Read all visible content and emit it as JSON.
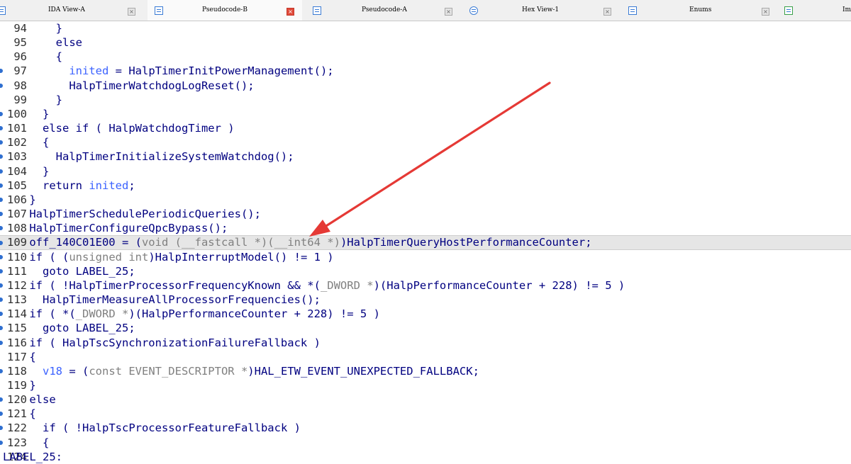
{
  "tabs": [
    {
      "label": "IDA View-A",
      "active": false
    },
    {
      "label": "Pseudocode-B",
      "active": true
    },
    {
      "label": "Pseudocode-A",
      "active": false
    },
    {
      "label": "Hex View-1",
      "active": false
    },
    {
      "label": "Enums",
      "active": false
    },
    {
      "label": "Im",
      "active": false
    }
  ],
  "close_glyph": "×",
  "colors": {
    "code_text": "#000080",
    "type_text": "#808080",
    "variable_text": "#3b62ff",
    "highlight_line": "#e6e6e6",
    "arrow": "#e53935"
  },
  "current_line": "109",
  "code_lines": [
    {
      "num": "94",
      "bp": false,
      "indent": "    ",
      "segments": [
        [
          "}",
          "n"
        ]
      ]
    },
    {
      "num": "95",
      "bp": false,
      "indent": "    ",
      "segments": [
        [
          "else",
          "n"
        ]
      ]
    },
    {
      "num": "96",
      "bp": false,
      "indent": "    ",
      "segments": [
        [
          "{",
          "n"
        ]
      ]
    },
    {
      "num": "97",
      "bp": true,
      "indent": "      ",
      "segments": [
        [
          "inited",
          "v"
        ],
        [
          " = HalpTimerInitPowerManagement();",
          "n"
        ]
      ]
    },
    {
      "num": "98",
      "bp": true,
      "indent": "      ",
      "segments": [
        [
          "HalpTimerWatchdogLogReset();",
          "n"
        ]
      ]
    },
    {
      "num": "99",
      "bp": false,
      "indent": "    ",
      "segments": [
        [
          "}",
          "n"
        ]
      ]
    },
    {
      "num": "100",
      "bp": true,
      "indent": "  ",
      "segments": [
        [
          "}",
          "n"
        ]
      ]
    },
    {
      "num": "101",
      "bp": true,
      "indent": "  ",
      "segments": [
        [
          "else if ( HalpWatchdogTimer )",
          "n"
        ]
      ]
    },
    {
      "num": "102",
      "bp": true,
      "indent": "  ",
      "segments": [
        [
          "{",
          "n"
        ]
      ]
    },
    {
      "num": "103",
      "bp": true,
      "indent": "    ",
      "segments": [
        [
          "HalpTimerInitializeSystemWatchdog();",
          "n"
        ]
      ]
    },
    {
      "num": "104",
      "bp": true,
      "indent": "  ",
      "segments": [
        [
          "}",
          "n"
        ]
      ]
    },
    {
      "num": "105",
      "bp": true,
      "indent": "  ",
      "segments": [
        [
          "return ",
          "n"
        ],
        [
          "inited",
          "v"
        ],
        [
          ";",
          "n"
        ]
      ]
    },
    {
      "num": "106",
      "bp": true,
      "indent": "",
      "segments": [
        [
          "}",
          "n"
        ]
      ]
    },
    {
      "num": "107",
      "bp": true,
      "indent": "",
      "segments": [
        [
          "HalpTimerSchedulePeriodicQueries();",
          "n"
        ]
      ]
    },
    {
      "num": "108",
      "bp": true,
      "indent": "",
      "segments": [
        [
          "HalpTimerConfigureQpcBypass();",
          "n"
        ]
      ]
    },
    {
      "num": "109",
      "bp": true,
      "indent": "",
      "segments": [
        [
          "off_140C01E00 = (",
          "n"
        ],
        [
          "void (__fastcall *)(__int64 *)",
          "g"
        ],
        [
          ")HalpTimerQueryHostPerformanceCounter;",
          "n"
        ]
      ]
    },
    {
      "num": "110",
      "bp": true,
      "indent": "",
      "segments": [
        [
          "if ( (",
          "n"
        ],
        [
          "unsigned int",
          "g"
        ],
        [
          ")HalpInterruptModel() != 1 )",
          "n"
        ]
      ]
    },
    {
      "num": "111",
      "bp": true,
      "indent": "  ",
      "segments": [
        [
          "goto LABEL_25;",
          "n"
        ]
      ]
    },
    {
      "num": "112",
      "bp": true,
      "indent": "",
      "segments": [
        [
          "if ( !HalpTimerProcessorFrequencyKnown && *(",
          "n"
        ],
        [
          "_DWORD *",
          "g"
        ],
        [
          ")(HalpPerformanceCounter + 228) != 5 )",
          "n"
        ]
      ]
    },
    {
      "num": "113",
      "bp": true,
      "indent": "  ",
      "segments": [
        [
          "HalpTimerMeasureAllProcessorFrequencies();",
          "n"
        ]
      ]
    },
    {
      "num": "114",
      "bp": true,
      "indent": "",
      "segments": [
        [
          "if ( *(",
          "n"
        ],
        [
          "_DWORD *",
          "g"
        ],
        [
          ")(HalpPerformanceCounter + 228) != 5 )",
          "n"
        ]
      ]
    },
    {
      "num": "115",
      "bp": true,
      "indent": "  ",
      "segments": [
        [
          "goto LABEL_25;",
          "n"
        ]
      ]
    },
    {
      "num": "116",
      "bp": true,
      "indent": "",
      "segments": [
        [
          "if ( HalpTscSynchronizationFailureFallback )",
          "n"
        ]
      ]
    },
    {
      "num": "117",
      "bp": false,
      "indent": "",
      "segments": [
        [
          "{",
          "n"
        ]
      ]
    },
    {
      "num": "118",
      "bp": true,
      "indent": "  ",
      "segments": [
        [
          "v18",
          "v"
        ],
        [
          " = (",
          "n"
        ],
        [
          "const EVENT_DESCRIPTOR *",
          "g"
        ],
        [
          ")HAL_ETW_EVENT_UNEXPECTED_FALLBACK;",
          "n"
        ]
      ]
    },
    {
      "num": "119",
      "bp": false,
      "indent": "",
      "segments": [
        [
          "}",
          "n"
        ]
      ]
    },
    {
      "num": "120",
      "bp": true,
      "indent": "",
      "segments": [
        [
          "else",
          "n"
        ]
      ]
    },
    {
      "num": "121",
      "bp": true,
      "indent": "",
      "segments": [
        [
          "{",
          "n"
        ]
      ]
    },
    {
      "num": "122",
      "bp": true,
      "indent": "  ",
      "segments": [
        [
          "if ( !HalpTscProcessorFeatureFallback )",
          "n"
        ]
      ]
    },
    {
      "num": "123",
      "bp": true,
      "indent": "  ",
      "segments": [
        [
          "{",
          "n"
        ]
      ]
    },
    {
      "num": "124",
      "bp": false,
      "indent": "",
      "segments": [
        [
          "LABEL_25:",
          "n"
        ]
      ],
      "outdent": true
    }
  ]
}
